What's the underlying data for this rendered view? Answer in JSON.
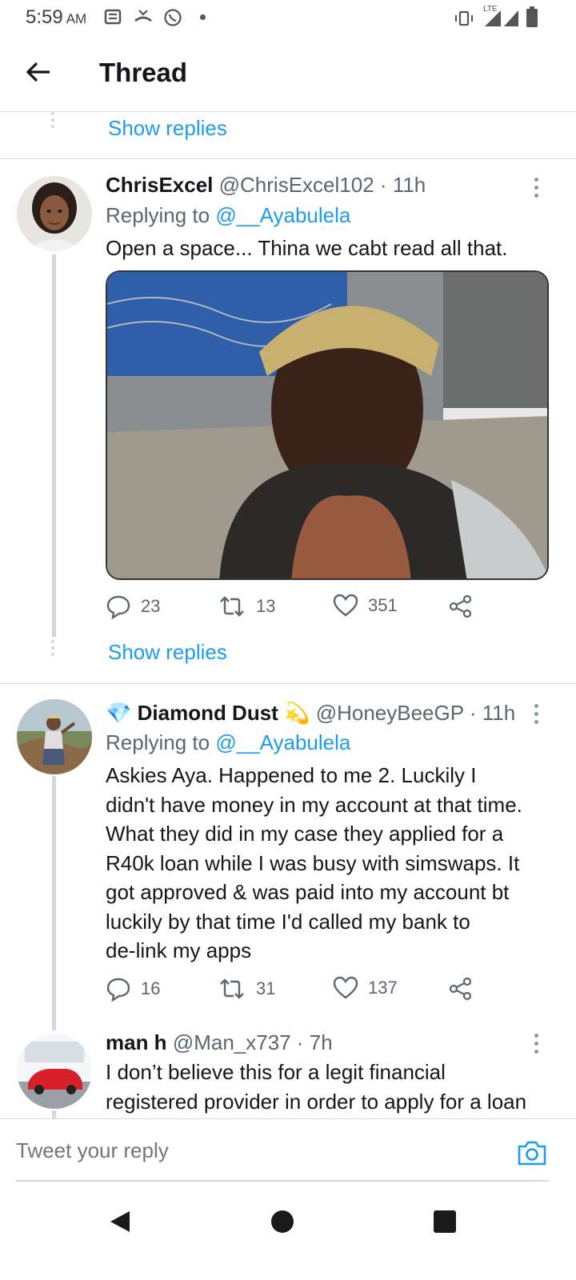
{
  "status_bar": {
    "time": "5:59",
    "ampm": "AM",
    "network": "LTE",
    "icons": [
      "notification-icon",
      "missed-call-icon",
      "whatsapp-icon",
      "dot-icon",
      "vibrate-icon",
      "signal-icon",
      "battery-icon"
    ]
  },
  "header": {
    "title": "Thread",
    "back_icon": "arrow-left-icon"
  },
  "thread": {
    "show_replies_top": "Show replies",
    "tweets": [
      {
        "name": "ChrisExcel",
        "handle": "@ChrisExcel102",
        "time": "11h",
        "replying_prefix": "Replying to",
        "replying_to": "@__Ayabulela",
        "text": "Open a space... Thina we cabt read all that.",
        "has_media": true,
        "replies": "23",
        "retweets": "13",
        "likes": "351",
        "show_replies": "Show replies"
      },
      {
        "name_emoji_prefix": "💎",
        "name": "Diamond Dust",
        "name_emoji_suffix": "💫",
        "handle": "@HoneyBeeGP",
        "time": "11h",
        "replying_prefix": "Replying to",
        "replying_to": "@__Ayabulela",
        "text_lines": [
          "Askies Aya.  Happened to me 2.  Luckily I",
          "didn't have money in my account at that time.",
          "What they did in my case they applied for a",
          "R40k loan while I was busy with simswaps.  It",
          "got approved & was paid into my account bt",
          "luckily by that time I'd called my bank to",
          "de-link my apps"
        ],
        "replies": "16",
        "retweets": "31",
        "likes": "137"
      },
      {
        "name": "man h",
        "handle": "@Man_x737",
        "time": "7h",
        "text_lines": [
          "I don’t believe this for a legit financial",
          "registered provider in order to apply for a loan"
        ]
      }
    ]
  },
  "reply_bar": {
    "placeholder": "Tweet your reply",
    "camera_icon": "camera-icon"
  },
  "colors": {
    "accent": "#1d9bf0",
    "secondary_text": "#5b6670",
    "divider": "#d9dde0"
  },
  "nav_bar": {
    "icons": [
      "nav-back-icon",
      "nav-home-icon",
      "nav-recents-icon"
    ]
  }
}
